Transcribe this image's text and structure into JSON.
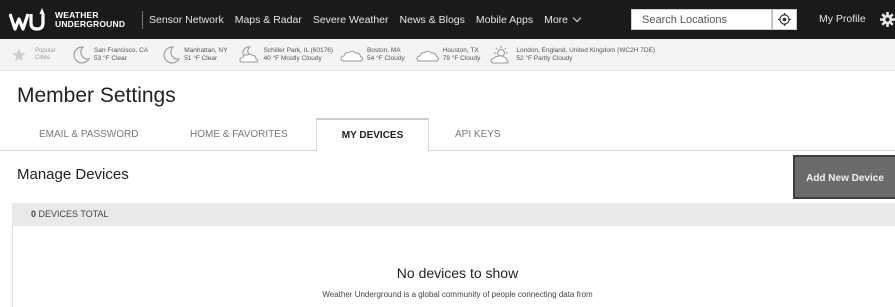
{
  "brand": {
    "line1": "WEATHER",
    "line2": "UNDERGROUND"
  },
  "nav": {
    "links": [
      "Sensor Network",
      "Maps & Radar",
      "Severe Weather",
      "News & Blogs",
      "Mobile Apps"
    ],
    "more_label": "More",
    "search_placeholder": "Search Locations",
    "profile_label": "My Profile"
  },
  "citybar": {
    "popular_line1": "Popular",
    "popular_line2": "Cities",
    "cities": [
      {
        "name": "San Francisco, CA",
        "conditions": "53 °F Clear",
        "icon": "moon-icon"
      },
      {
        "name": "Manhattan, NY",
        "conditions": "51 °F Clear",
        "icon": "moon-icon"
      },
      {
        "name": "Schiller Park, IL (60176)",
        "conditions": "40 °F Mostly Cloudy",
        "icon": "moon-cloud-icon"
      },
      {
        "name": "Boston, MA",
        "conditions": "54 °F Cloudy",
        "icon": "cloud-icon"
      },
      {
        "name": "Houston, TX",
        "conditions": "79 °F Cloudy",
        "icon": "cloud-icon"
      },
      {
        "name": "London, England, United Kingdom (WC2H 7DE)",
        "conditions": "52 °F Partly Cloudy",
        "icon": "sun-cloud-icon"
      }
    ]
  },
  "page": {
    "title": "Member Settings",
    "tabs": [
      {
        "label": "EMAIL & PASSWORD",
        "active": false
      },
      {
        "label": "HOME & FAVORITES",
        "active": false
      },
      {
        "label": "MY DEVICES",
        "active": true
      },
      {
        "label": "API KEYS",
        "active": false
      }
    ],
    "section_title": "Manage Devices",
    "add_button": "Add New Device",
    "total_count": "0",
    "total_label": "DEVICES TOTAL",
    "empty_title": "No devices to show",
    "empty_subtitle": "Weather Underground is a global community of people connecting data from"
  }
}
